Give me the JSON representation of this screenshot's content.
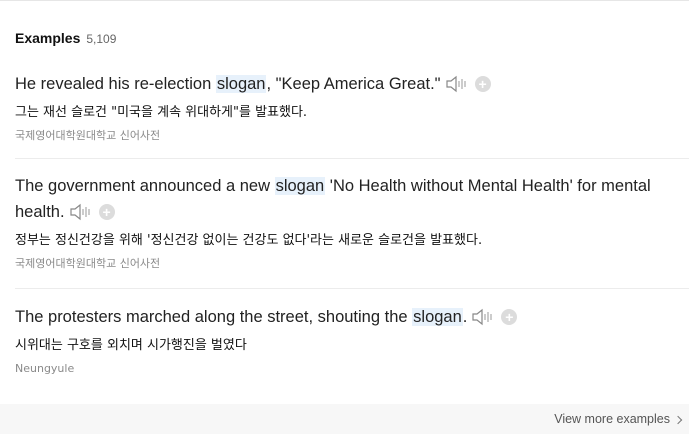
{
  "section": {
    "title": "Examples",
    "count": "5,109"
  },
  "examples": [
    {
      "en_before": "He revealed his re-election ",
      "keyword": "slogan",
      "en_after": ", \"Keep America Great.\"",
      "ko": "그는 재선 슬로건 \"미국을 계속 위대하게\"를 발표했다.",
      "source": "국제영어대학원대학교 신어사전"
    },
    {
      "en_before": "The government announced a new ",
      "keyword": "slogan",
      "en_after": " 'No Health without Mental Health' for mental health.",
      "ko": "정부는 정신건강을 위해 '정신건강 없이는 건강도 없다'라는 새로운 슬로건을 발표했다.",
      "source": "국제영어대학원대학교 신어사전"
    },
    {
      "en_before": "The protesters marched along the street, shouting the ",
      "keyword": "slogan",
      "en_after": ".",
      "ko": "시위대는 구호를 외치며 시가행진을 벌였다",
      "source": "Neungyule"
    }
  ],
  "icons": {
    "speaker": "speaker-icon",
    "add": "plus-circle-icon",
    "chevron": "chevron-right-icon"
  },
  "colors": {
    "keyword_highlight": "#e7f1fb",
    "source_text": "#8a8a8a",
    "footer_bg": "#f7f7f7"
  },
  "footer": {
    "view_more_label": "View more examples"
  }
}
